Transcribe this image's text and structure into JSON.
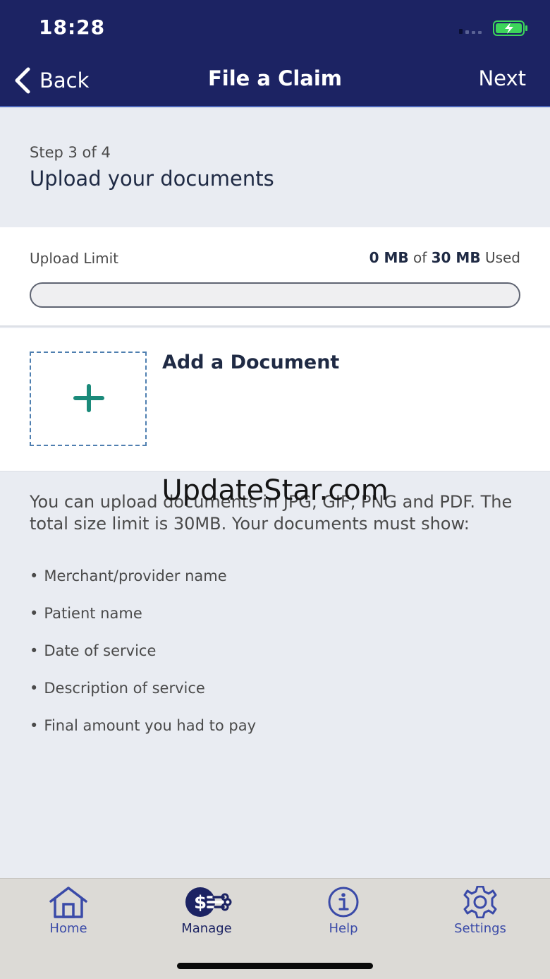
{
  "status_bar": {
    "time": "18:28"
  },
  "nav": {
    "back_label": "Back",
    "title": "File a Claim",
    "next_label": "Next"
  },
  "step": {
    "label": "Step 3 of 4",
    "title": "Upload your documents"
  },
  "upload_limit": {
    "label": "Upload Limit",
    "used_value": "0 MB",
    "of_text": "of",
    "limit_value": "30 MB",
    "used_suffix": "Used",
    "used_fraction": 0
  },
  "add_document": {
    "title": "Add a Document"
  },
  "info": {
    "text": "You can upload documents in JPG, GIF, PNG and PDF. The total size limit is 30MB. Your documents must show:",
    "requirements": [
      "Merchant/provider name",
      "Patient name",
      "Date of service",
      "Description of service",
      "Final amount you had to pay"
    ]
  },
  "watermark": "UpdateStar.com",
  "tabs": [
    {
      "label": "Home",
      "icon": "home-icon"
    },
    {
      "label": "Manage",
      "icon": "manage-dollar-icon",
      "active": true
    },
    {
      "label": "Help",
      "icon": "info-icon"
    },
    {
      "label": "Settings",
      "icon": "gear-icon"
    }
  ],
  "colors": {
    "header": "#1c2363",
    "accent_green": "#1b8a7a",
    "tab_blue": "#3a4aa8",
    "background": "#e9ecf2"
  }
}
